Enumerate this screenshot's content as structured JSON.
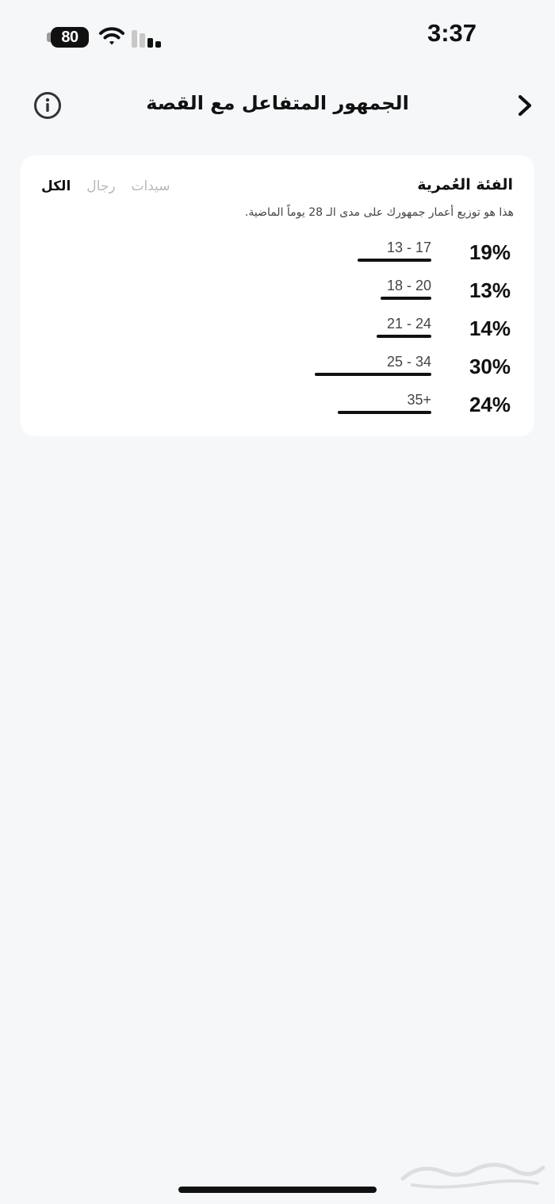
{
  "status_bar": {
    "battery_level": "80",
    "time": "3:37"
  },
  "nav": {
    "title": "الجمهور المتفاعل مع القصة",
    "info_icon": "info-circle-icon",
    "back_icon": "chevron-right-icon"
  },
  "age_section": {
    "title": "الفئة العُمرية",
    "description": "هذا هو توزيع أعمار جمهورك على مدى الـ 28 يوماً الماضية.",
    "filters": [
      {
        "label": "الكل",
        "active": true
      },
      {
        "label": "رجال",
        "active": false
      },
      {
        "label": "سيدات",
        "active": false
      }
    ],
    "rows": [
      {
        "range": "13 - 17",
        "percent_label": "19%",
        "value": 19
      },
      {
        "range": "18 - 20",
        "percent_label": "13%",
        "value": 13
      },
      {
        "range": "21 - 24",
        "percent_label": "14%",
        "value": 14
      },
      {
        "range": "25 - 34",
        "percent_label": "30%",
        "value": 30
      },
      {
        "range": "35+",
        "percent_label": "24%",
        "value": 24
      }
    ]
  },
  "colors": {
    "background": "#f5f7f9",
    "card": "#ffffff",
    "text": "#111111",
    "muted": "#b7b9bc"
  }
}
